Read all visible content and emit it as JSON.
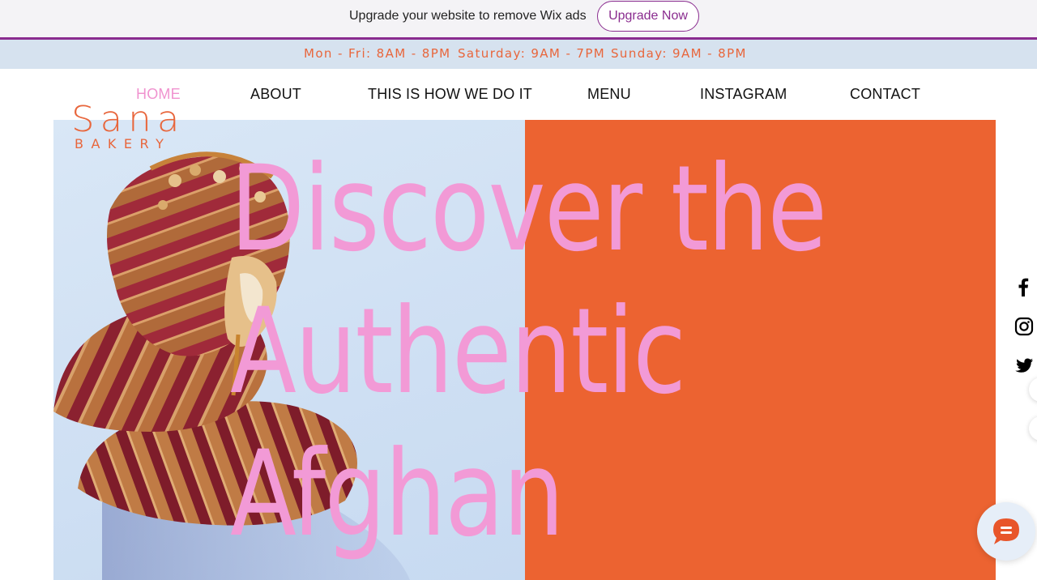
{
  "wix_banner": {
    "message": "Upgrade your website to remove Wix ads",
    "button_label": "Upgrade Now"
  },
  "hours": {
    "weekdays": "Mon - Fri: 8AM - 8PM",
    "saturday": "Saturday: 9AM - 7PM",
    "sunday": "Sunday: 9AM - 8PM"
  },
  "nav": {
    "items": [
      {
        "label": "HOME",
        "active": true
      },
      {
        "label": "ABOUT"
      },
      {
        "label": "THIS IS HOW WE DO IT"
      },
      {
        "label": "MENU"
      },
      {
        "label": "INSTAGRAM"
      },
      {
        "label": "CONTACT"
      }
    ]
  },
  "logo": {
    "name": "Sana",
    "subtitle": "BAKERY"
  },
  "hero": {
    "headline_lines": [
      "Discover the",
      "Authentic",
      "Afghan"
    ]
  },
  "social": {
    "icons": [
      "facebook-icon",
      "instagram-icon",
      "twitter-icon"
    ]
  },
  "colors": {
    "accent_orange": "#ec6331",
    "headline_pink": "#f29ad6",
    "wix_purple": "#8a2c8f",
    "hours_bar": "#d6e2ef",
    "hero_left_blue": "#cfe0f3"
  },
  "chat": {
    "icon": "chat-bubble-icon"
  }
}
